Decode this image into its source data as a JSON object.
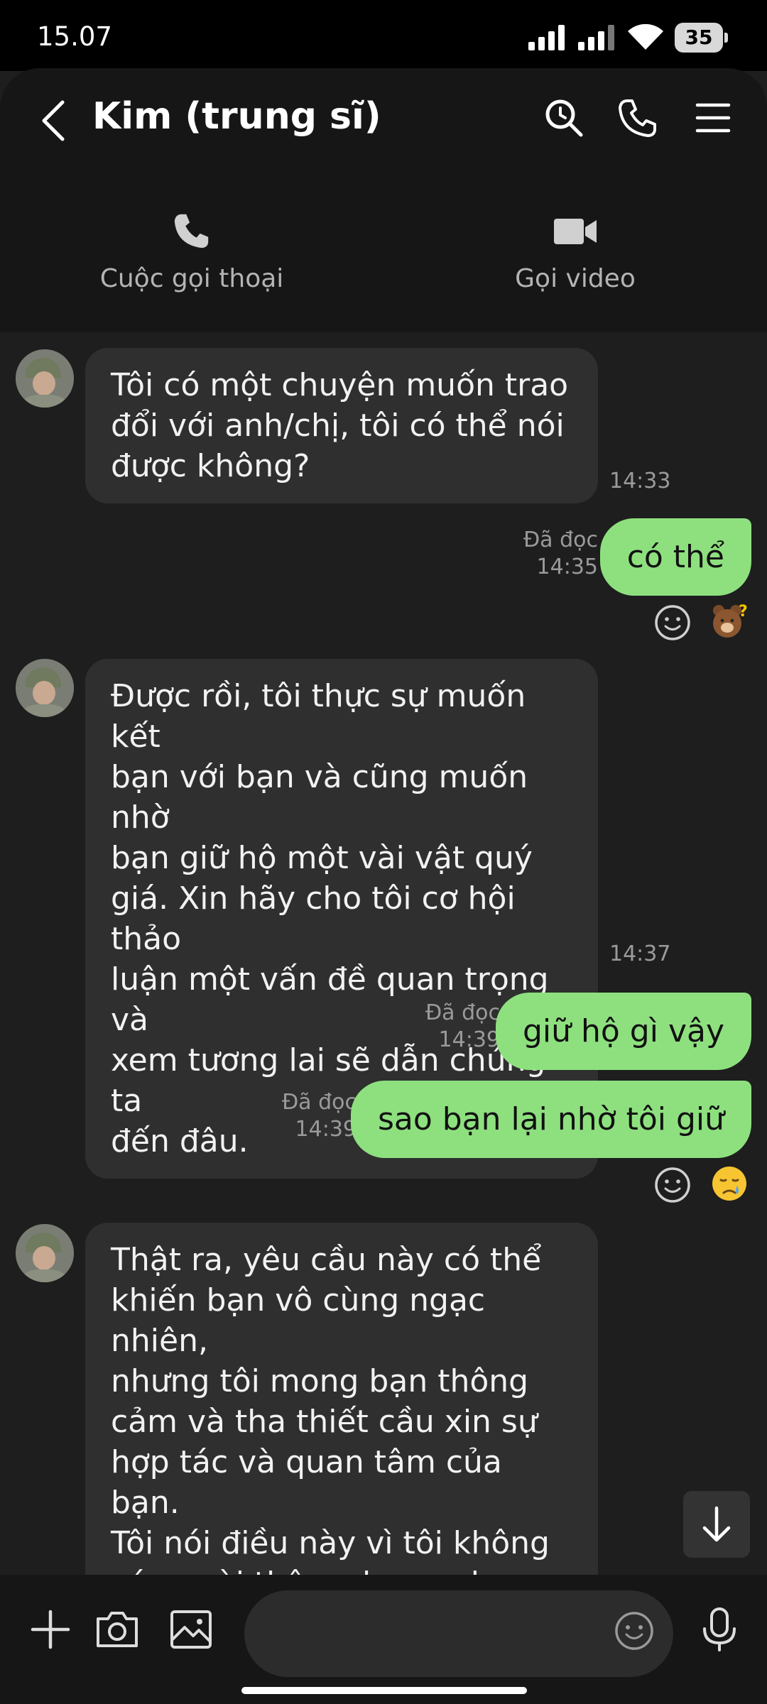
{
  "status": {
    "time": "15.07",
    "battery": "35"
  },
  "header": {
    "title": "Kim (trung sĩ)",
    "voice_call_label": "Cuộc gọi thoại",
    "video_call_label": "Gọi video"
  },
  "messages": [
    {
      "dir": "in",
      "text": "Tôi có một chuyện muốn trao\nđổi với anh/chị, tôi có thể nói\nđược không?",
      "time": "14:33"
    },
    {
      "dir": "out",
      "text": "có thể",
      "read": "Đã đọc",
      "time": "14:35",
      "reaction": "bear-confused-sticker"
    },
    {
      "dir": "in",
      "text": "Được rồi, tôi thực sự muốn kết\nbạn với bạn và cũng muốn nhờ\nbạn giữ hộ một vài vật quý\ngiá. Xin hãy cho tôi cơ hội thảo\nluận một vấn đề quan trọng và\nxem tương lai sẽ dẫn chúng ta\nđến đâu.",
      "time": "14:37"
    },
    {
      "dir": "out",
      "text": "giữ hộ gì vậy",
      "read": "Đã đọc",
      "time": "14:39"
    },
    {
      "dir": "out",
      "text": "sao bạn lại nhờ tôi giữ",
      "read": "Đã đọc",
      "time": "14:39",
      "reaction": "sad-face-emoji"
    },
    {
      "dir": "in",
      "text": "Thật ra, yêu cầu này có thể\nkhiến bạn vô cùng ngạc nhiên,\nnhưng tôi mong bạn thông\ncảm và tha thiết cầu xin sự\nhợp tác và quan tâm của bạn.\nTôi nói điều này vì tôi không\ncó người thân, cha mẹ hay anh\nchị em nào để cùng thảo luận.\nTôi rất mong bạn sẽ giúp tôi",
      "time": ""
    }
  ],
  "input": {
    "placeholder": ""
  },
  "colors": {
    "outgoing_bubble": "#8ee07f",
    "incoming_bubble": "#2f2f2f",
    "background": "#1e1e1e"
  }
}
